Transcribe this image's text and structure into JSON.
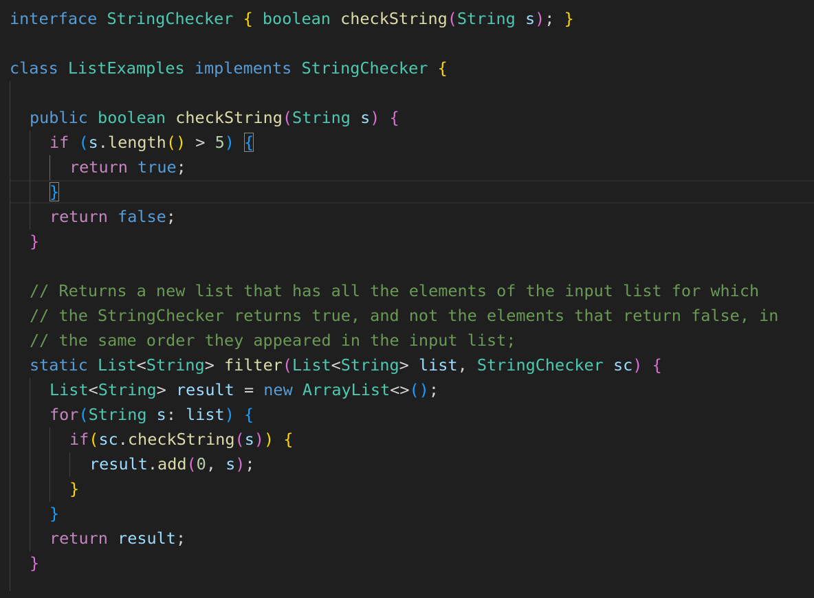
{
  "colors": {
    "background": "#1f1f1f",
    "keyword_blue": "#569cd6",
    "control_purple": "#c586c0",
    "type_teal": "#4ec9b0",
    "function_yellow": "#dcdcaa",
    "variable_light_blue": "#9cdcfe",
    "number_green": "#b5cea8",
    "comment_green": "#6a9955",
    "bracket_gold": "#ffd700",
    "bracket_pink": "#da70d6",
    "bracket_blue": "#179fff",
    "plain": "#d4d4d4"
  },
  "code_lines": [
    {
      "text": "interface StringChecker { boolean checkString(String s); }"
    },
    {
      "text": ""
    },
    {
      "text": "class ListExamples implements StringChecker {"
    },
    {
      "text": ""
    },
    {
      "text": "  public boolean checkString(String s) {"
    },
    {
      "text": "    if (s.length() > 5) {"
    },
    {
      "text": "      return true;"
    },
    {
      "text": "    }"
    },
    {
      "text": "    return false;"
    },
    {
      "text": "  }"
    },
    {
      "text": ""
    },
    {
      "text": "  // Returns a new list that has all the elements of the input list for which"
    },
    {
      "text": "  // the StringChecker returns true, and not the elements that return false, in"
    },
    {
      "text": "  // the same order they appeared in the input list;"
    },
    {
      "text": "  static List<String> filter(List<String> list, StringChecker sc) {"
    },
    {
      "text": "    List<String> result = new ArrayList<>();"
    },
    {
      "text": "    for(String s: list) {"
    },
    {
      "text": "      if(sc.checkString(s)) {"
    },
    {
      "text": "        result.add(0, s);"
    },
    {
      "text": "      }"
    },
    {
      "text": "    }"
    },
    {
      "text": "    return result;"
    },
    {
      "text": "  }"
    }
  ]
}
